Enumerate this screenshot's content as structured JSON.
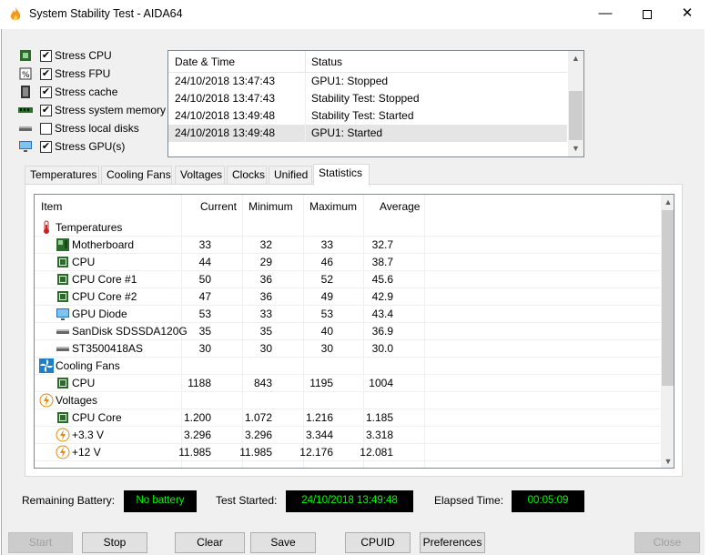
{
  "window": {
    "title": "System Stability Test - AIDA64"
  },
  "stress_options": [
    {
      "label": "Stress CPU",
      "checked": true,
      "icon": "cpu-chip-icon"
    },
    {
      "label": "Stress FPU",
      "checked": true,
      "icon": "fpu-icon"
    },
    {
      "label": "Stress cache",
      "checked": true,
      "icon": "cache-icon"
    },
    {
      "label": "Stress system memory",
      "checked": true,
      "icon": "memory-icon"
    },
    {
      "label": "Stress local disks",
      "checked": false,
      "icon": "disk-icon"
    },
    {
      "label": "Stress GPU(s)",
      "checked": true,
      "icon": "monitor-icon"
    }
  ],
  "log": {
    "headers": {
      "datetime": "Date & Time",
      "status": "Status"
    },
    "rows": [
      {
        "datetime": "24/10/2018 13:47:43",
        "status": "GPU1: Stopped"
      },
      {
        "datetime": "24/10/2018 13:47:43",
        "status": "Stability Test: Stopped"
      },
      {
        "datetime": "24/10/2018 13:49:48",
        "status": "Stability Test: Started"
      },
      {
        "datetime": "24/10/2018 13:49:48",
        "status": "GPU1: Started"
      }
    ]
  },
  "tabs": [
    "Temperatures",
    "Cooling Fans",
    "Voltages",
    "Clocks",
    "Unified",
    "Statistics"
  ],
  "active_tab": "Statistics",
  "stats": {
    "headers": {
      "item": "Item",
      "current": "Current",
      "minimum": "Minimum",
      "maximum": "Maximum",
      "average": "Average"
    },
    "rows": [
      {
        "type": "group",
        "name": "Temperatures",
        "icon": "thermometer-icon"
      },
      {
        "type": "item",
        "name": "Motherboard",
        "icon": "motherboard-icon",
        "current": "33",
        "minimum": "32",
        "maximum": "33",
        "average": "32.7"
      },
      {
        "type": "item",
        "name": "CPU",
        "icon": "cpu-chip-icon",
        "current": "44",
        "minimum": "29",
        "maximum": "46",
        "average": "38.7"
      },
      {
        "type": "item",
        "name": "CPU Core #1",
        "icon": "cpu-chip-icon",
        "current": "50",
        "minimum": "36",
        "maximum": "52",
        "average": "45.6"
      },
      {
        "type": "item",
        "name": "CPU Core #2",
        "icon": "cpu-chip-icon",
        "current": "47",
        "minimum": "36",
        "maximum": "49",
        "average": "42.9"
      },
      {
        "type": "item",
        "name": "GPU Diode",
        "icon": "monitor-icon",
        "current": "53",
        "minimum": "33",
        "maximum": "53",
        "average": "43.4"
      },
      {
        "type": "item",
        "name": "SanDisk SDSSDA120G",
        "icon": "disk-icon",
        "current": "35",
        "minimum": "35",
        "maximum": "40",
        "average": "36.9"
      },
      {
        "type": "item",
        "name": "ST3500418AS",
        "icon": "disk-icon",
        "current": "30",
        "minimum": "30",
        "maximum": "30",
        "average": "30.0"
      },
      {
        "type": "group",
        "name": "Cooling Fans",
        "icon": "fan-icon"
      },
      {
        "type": "item",
        "name": "CPU",
        "icon": "cpu-chip-icon",
        "current": "1188",
        "minimum": "843",
        "maximum": "1195",
        "average": "1004"
      },
      {
        "type": "group",
        "name": "Voltages",
        "icon": "lightning-icon"
      },
      {
        "type": "item",
        "name": "CPU Core",
        "icon": "cpu-chip-icon",
        "current": "1.200",
        "minimum": "1.072",
        "maximum": "1.216",
        "average": "1.185"
      },
      {
        "type": "item",
        "name": "+3.3 V",
        "icon": "lightning-icon",
        "current": "3.296",
        "minimum": "3.296",
        "maximum": "3.344",
        "average": "3.318"
      },
      {
        "type": "item",
        "name": "+12 V",
        "icon": "lightning-icon",
        "current": "11.985",
        "minimum": "11.985",
        "maximum": "12.176",
        "average": "12.081"
      }
    ]
  },
  "status": {
    "battery_label": "Remaining Battery:",
    "battery_value": "No battery",
    "started_label": "Test Started:",
    "started_value": "24/10/2018 13:49:48",
    "elapsed_label": "Elapsed Time:",
    "elapsed_value": "00:05:09"
  },
  "buttons": {
    "start": "Start",
    "stop": "Stop",
    "clear": "Clear",
    "save": "Save",
    "cpuid": "CPUID",
    "preferences": "Preferences",
    "close": "Close"
  },
  "colors": {
    "status_box_bg": "#000000",
    "status_box_text": "#00ff00"
  }
}
